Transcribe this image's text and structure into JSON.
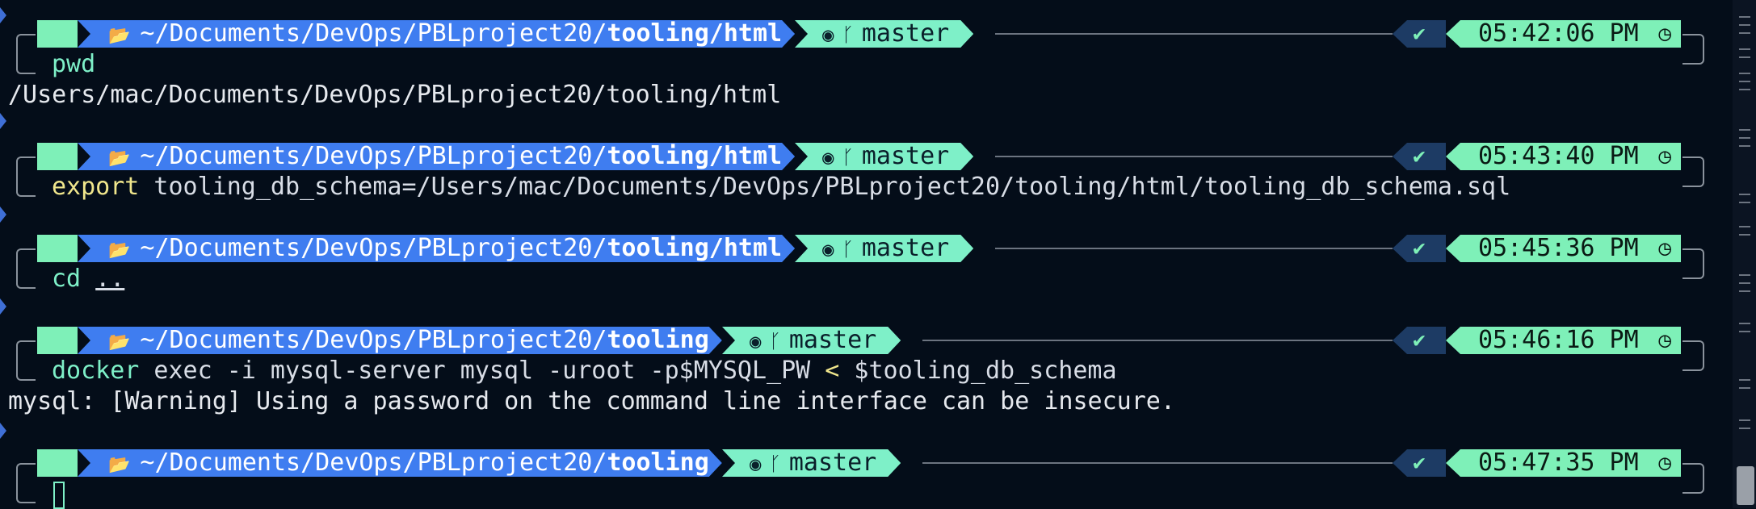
{
  "prompts": [
    {
      "path_plain": "~/Documents/DevOps/PBLproject20/",
      "path_bold": "tooling/html",
      "branch": "master",
      "status": "✔",
      "time": "05:42:06 PM",
      "command": "pwd",
      "output": "/Users/mac/Documents/DevOps/PBLproject20/tooling/html"
    },
    {
      "path_plain": "~/Documents/DevOps/PBLproject20/",
      "path_bold": "tooling/html",
      "branch": "master",
      "status": "✔",
      "time": "05:43:40 PM",
      "command_keyword": "export",
      "command_rest": " tooling_db_schema=/Users/mac/Documents/DevOps/PBLproject20/tooling/html/tooling_db_schema.sql"
    },
    {
      "path_plain": "~/Documents/DevOps/PBLproject20/",
      "path_bold": "tooling/html",
      "branch": "master",
      "status": "✔",
      "time": "05:45:36 PM",
      "command_keyword": "cd",
      "command_rest": ".."
    },
    {
      "path_plain": "~/Documents/DevOps/PBLproject20/",
      "path_bold": "tooling",
      "branch": "master",
      "status": "✔",
      "time": "05:46:16 PM",
      "command_keyword": "docker",
      "command_mid": " exec -i mysql-server mysql -uroot -p$MYSQL_PW ",
      "command_redirect": "<",
      "command_end": " $tooling_db_schema",
      "output": "mysql: [Warning] Using a password on the command line interface can be insecure."
    },
    {
      "path_plain": "~/Documents/DevOps/PBLproject20/",
      "path_bold": "tooling",
      "branch": "master",
      "status": "✔",
      "time": "05:47:35 PM"
    }
  ],
  "icons": {
    "os": "apple-icon",
    "folder": "folder-icon",
    "git": "github-icon",
    "branch": "git-branch-icon",
    "clock": "clock-icon"
  },
  "colors": {
    "background": "#040d19",
    "path_segment": "#3f7df0",
    "git_segment": "#7ef0c8",
    "time_segment": "#7ef0b8",
    "command": "#7ef0c8",
    "keyword_yellow": "#f0e68c"
  }
}
